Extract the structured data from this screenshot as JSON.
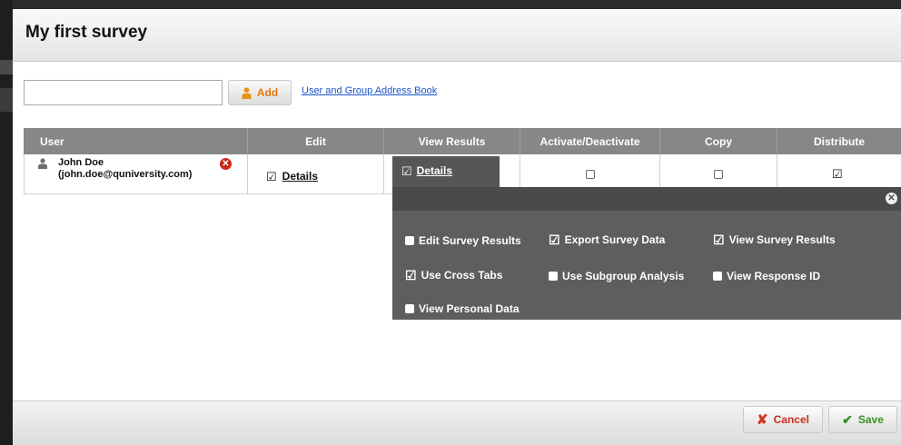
{
  "dialog": {
    "title": "My first survey"
  },
  "search": {
    "value": "",
    "placeholder": ""
  },
  "add_label": "Add",
  "address_book": "User and Group Address Book",
  "table": {
    "headers": [
      "User",
      "Edit",
      "View Results",
      "Activate/Deactivate",
      "Copy",
      "Distribute"
    ],
    "row": {
      "name": "John Doe",
      "email": "(john.doe@quniversity.com)",
      "edit_link": "Details",
      "view_link": "Details",
      "edit_checked": true,
      "view_checked": true,
      "activate_checked": false,
      "copy_checked": false,
      "distribute_checked": true
    }
  },
  "permissions": [
    {
      "label": "Edit Survey Results",
      "checked": false
    },
    {
      "label": "Export Survey Data",
      "checked": true
    },
    {
      "label": "View Survey Results",
      "checked": true
    },
    {
      "label": "Use Cross Tabs",
      "checked": true
    },
    {
      "label": "Use Subgroup Analysis",
      "checked": false
    },
    {
      "label": "View Response ID",
      "checked": false
    },
    {
      "label": "View Personal Data",
      "checked": false
    }
  ],
  "footer": {
    "cancel": "Cancel",
    "save": "Save"
  },
  "colors": {
    "header_bg": "#878787",
    "popup_bg": "#5e5e5e",
    "add_accent": "#e8770f",
    "cancel_accent": "#d4351c",
    "save_accent": "#3a8f1e",
    "link": "#1a55c8"
  },
  "icons": [
    "user-icon",
    "add-user-icon",
    "remove-icon",
    "close-icon",
    "cancel-icon",
    "save-check-icon"
  ]
}
